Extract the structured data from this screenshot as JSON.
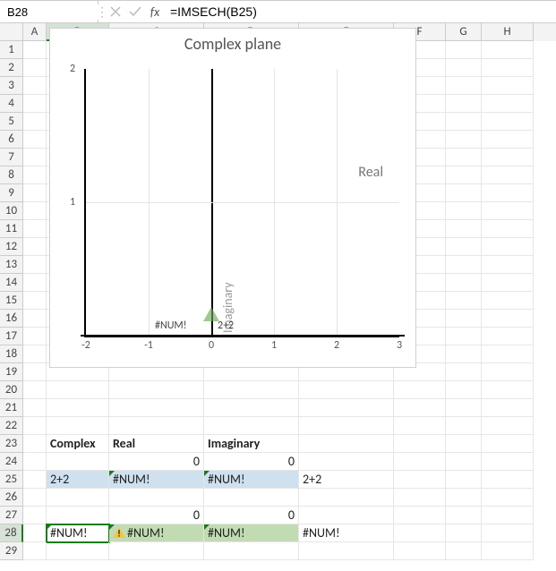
{
  "formula_bar": {
    "namebox_value": "B28",
    "formula_value": "=IMSECH(B25)"
  },
  "columns": [
    "A",
    "B",
    "C",
    "D",
    "E",
    "F",
    "G",
    "H"
  ],
  "rows_count": 29,
  "selected_cell": {
    "col": "B",
    "row": 28
  },
  "headers_row": 23,
  "headers": {
    "B": "Complex",
    "C": "Real",
    "D": "Imaginary"
  },
  "cells": {
    "C24": "0",
    "D24": "0",
    "B25": "2+2",
    "C25": "#NUM!",
    "D25": "#NUM!",
    "E25": "2+2",
    "C27": "0",
    "D27": "0",
    "B28": "#NUM!",
    "C28": "#NUM!",
    "D28": "#NUM!",
    "E28": "#NUM!"
  },
  "chart_data": {
    "type": "scatter",
    "title": "Complex plane",
    "xlabel": "Imaginary",
    "ylabel_right": "Real",
    "xlim": [
      -2,
      3
    ],
    "ylim": [
      0,
      2
    ],
    "x_ticks": [
      -2,
      -1,
      0,
      1,
      2,
      3
    ],
    "y_ticks": [
      1,
      2
    ],
    "series": [
      {
        "name": "2+2",
        "x": 0,
        "y": 0,
        "label": "2+2"
      },
      {
        "name": "#NUM!",
        "x": null,
        "y": null,
        "label": "#NUM!"
      }
    ],
    "axis_label_real": "Real",
    "axis_label_imag": "Imaginary"
  }
}
